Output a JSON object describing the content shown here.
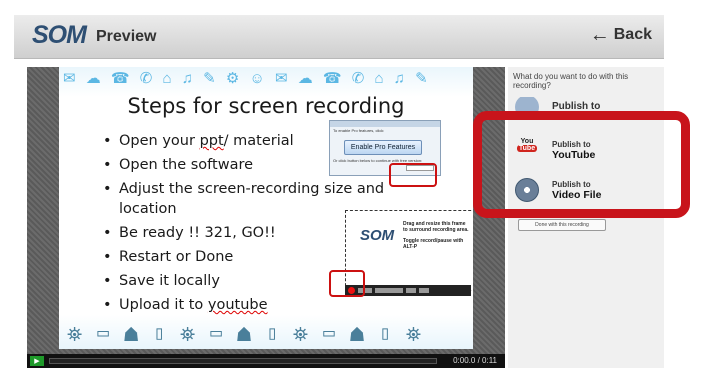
{
  "header": {
    "logo": "SOM",
    "title": "Preview",
    "back_label": "Back",
    "back_icon": "←"
  },
  "slide": {
    "title": "Steps for screen recording",
    "bullets": [
      "Open your ppt/ material",
      "Open the software",
      "Adjust the screen-recording size and location",
      "Be ready !! 321, GO!!",
      "Restart or Done",
      "Save it locally",
      "Upload it to youtube"
    ],
    "pro_window": {
      "caption": "To enable Pro features, click:",
      "button": "Enable Pro Features",
      "hint": "Or click button below to continue with free version:"
    },
    "record_frame": {
      "logo": "SOM",
      "drag_text": "Drag and resize this frame to surround recording area.",
      "toggle_text": "Toggle record/pause with ALT-P"
    }
  },
  "player": {
    "time": "0:00.0 / 0:11",
    "play_icon": "▶"
  },
  "panel": {
    "question": "What do you want to do with this recording?",
    "options": [
      {
        "line1": "Publish to",
        "line2": "",
        "icon": "publish-icon"
      },
      {
        "line1": "Publish to",
        "line2": "YouTube",
        "icon": "youtube-icon"
      },
      {
        "line1": "Publish to",
        "line2": "Video File",
        "icon": "film-reel-icon"
      }
    ],
    "done_label": "Done with this recording"
  },
  "youtube_icon": {
    "top": "You",
    "bottom": "Tube"
  },
  "colors": {
    "annotation_red": "#c8141b",
    "youtube_red": "#d0251e",
    "play_green": "#1e9a2a"
  }
}
